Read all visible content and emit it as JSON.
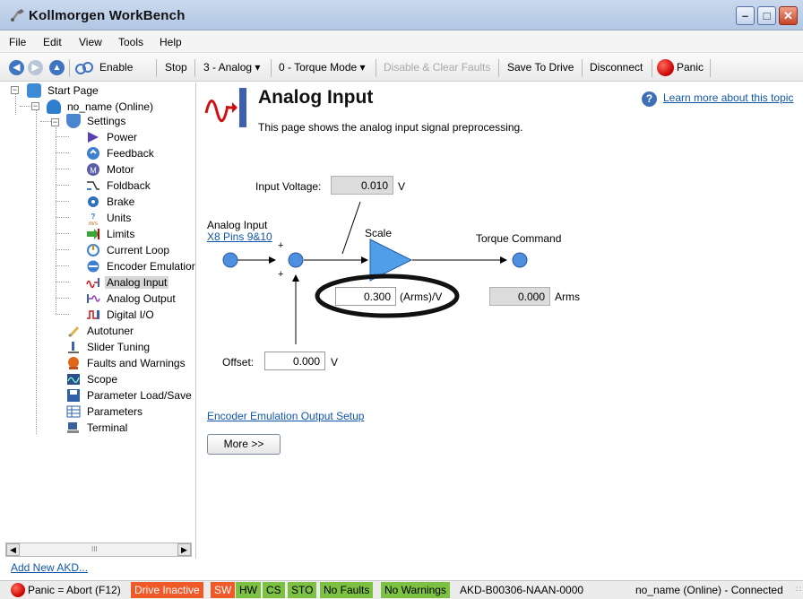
{
  "window": {
    "title": "Kollmorgen WorkBench",
    "minimize": "–",
    "maximize": "□",
    "close": "✕"
  },
  "menu": [
    "File",
    "Edit",
    "View",
    "Tools",
    "Help"
  ],
  "toolbar": {
    "enable": "Enable",
    "stop": "Stop",
    "op_mode": "3 - Analog ▾",
    "cmd_mode": "0 - Torque Mode ▾",
    "disable_clear": "Disable & Clear Faults",
    "save": "Save To Drive",
    "disconnect": "Disconnect",
    "panic": "Panic"
  },
  "tree": {
    "start_page": "Start Page",
    "device": "no_name (Online)",
    "settings": "Settings",
    "items": [
      "Power",
      "Feedback",
      "Motor",
      "Foldback",
      "Brake",
      "Units",
      "Limits",
      "Current Loop",
      "Encoder Emulatior",
      "Analog Input",
      "Analog Output",
      "Digital I/O"
    ],
    "tools": [
      "Autotuner",
      "Slider Tuning",
      "Faults and Warnings",
      "Scope",
      "Parameter Load/Save",
      "Parameters",
      "Terminal"
    ],
    "hscroll_mark": "III",
    "add_new": "Add New AKD..."
  },
  "page": {
    "title": "Analog Input",
    "description": "This page shows the analog input signal preprocessing.",
    "help_link": "Learn more about this topic",
    "input_voltage_label": "Input Voltage:",
    "input_voltage_value": "0.010",
    "input_voltage_unit": "V",
    "analog_input_label": "Analog Input",
    "pins_link": "X8 Pins 9&10",
    "plus_top": "+",
    "plus_bottom": "+",
    "scale_label": "Scale",
    "scale_value": "0.300",
    "scale_unit": "(Arms)/V",
    "torque_label": "Torque Command",
    "torque_value": "0.000",
    "torque_unit": "Arms",
    "offset_label": "Offset:",
    "offset_value": "0.000",
    "offset_unit": "V",
    "encoder_link": "Encoder Emulation Output Setup",
    "more_button": "More >>"
  },
  "status": {
    "panic": "Panic = Abort (F12)",
    "drive_inactive": "Drive Inactive",
    "sw": "SW",
    "hw": "HW",
    "cs": "CS",
    "sto": "STO",
    "no_faults": "No Faults",
    "no_warnings": "No Warnings",
    "model": "AKD-B00306-NAAN-0000",
    "connection": "no_name (Online) - Connected",
    "grip": "∷"
  },
  "colors": {
    "diagram_blue": "#4f8fe0",
    "status_red": "#f05a28",
    "status_green": "#7cc142",
    "link": "#1155aa"
  }
}
